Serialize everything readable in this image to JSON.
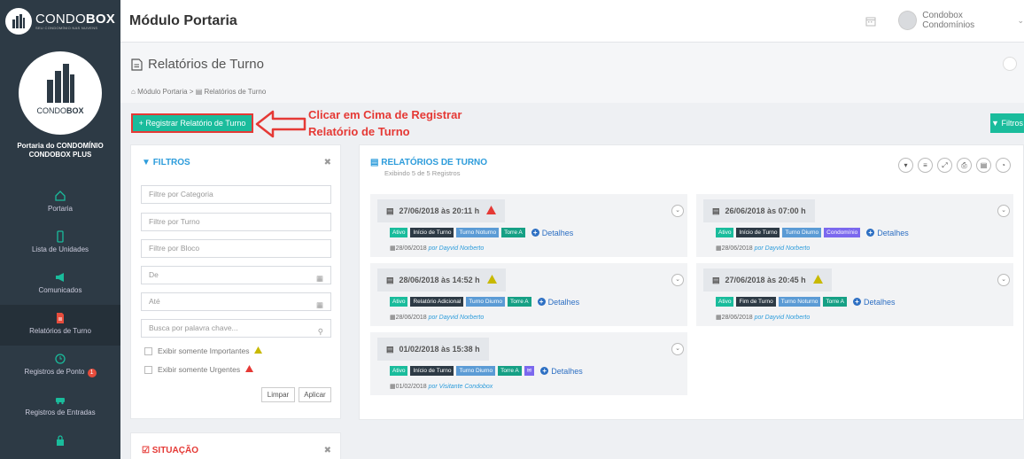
{
  "brand": {
    "name_light": "CONDO",
    "name_bold": "BOX",
    "tagline": "SEU CONDOMÍNIO NAS NUVENS"
  },
  "header": {
    "module_title": "Módulo Portaria",
    "user_name": "Condobox Condomínios"
  },
  "sidebar": {
    "logo_light": "CONDO",
    "logo_bold": "BOX",
    "portaria_name": "Portaria do CONDOMÍNIO CONDOBOX PLUS",
    "items": [
      {
        "label": "Portaria"
      },
      {
        "label": "Lista de Unidades"
      },
      {
        "label": "Comunicados"
      },
      {
        "label": "Relatórios de Turno"
      },
      {
        "label": "Registros de Ponto",
        "badge": "1"
      },
      {
        "label": "Registros de Entradas"
      }
    ]
  },
  "page": {
    "title": "Relatórios de Turno",
    "breadcrumb": {
      "home": "Módulo Portaria",
      "sep": ">",
      "current": "Relatórios de Turno"
    }
  },
  "toolbar": {
    "register_label": "+ Registrar Relatório de Turno",
    "filtros_label": "Filtros",
    "annotation_line1": "Clicar em Cima de Registrar",
    "annotation_line2": "Relatório de Turno"
  },
  "filters": {
    "title": "FILTROS",
    "categoria": "Filtre por Categoria",
    "turno": "Filtre por Turno",
    "bloco": "Filtre por Bloco",
    "de": "De",
    "ate": "Até",
    "busca": "Busca por palavra chave...",
    "importantes": "Exibir somente Importantes",
    "urgentes": "Exibir somente Urgentes",
    "limpar": "Limpar",
    "aplicar": "Aplicar"
  },
  "situacao": {
    "title": "SITUAÇÃO"
  },
  "reports": {
    "title": "RELATÓRIOS DE TURNO",
    "subtitle": "Exibindo 5 de 5 Registros",
    "details_label": "Detalhes",
    "cards": [
      {
        "title": "27/06/2018 às 20:11 h",
        "warn": "red",
        "tags": [
          "Ativo",
          "Início de Turno",
          "Turno Noturno",
          "Torre A"
        ],
        "date": "28/06/2018",
        "by": "por Dayvid Norberto"
      },
      {
        "title": "26/06/2018 às 07:00 h",
        "warn": "",
        "tags": [
          "Ativo",
          "Início de Turno",
          "Turno Diurno",
          "Condomínio"
        ],
        "date": "28/06/2018",
        "by": "por Dayvid Norberto"
      },
      {
        "title": "28/06/2018 às 14:52 h",
        "warn": "yellow",
        "tags": [
          "Ativo",
          "Relatório Adicional",
          "Turno Diurno",
          "Torre A"
        ],
        "date": "28/06/2018",
        "by": "por Dayvid Norberto"
      },
      {
        "title": "27/06/2018 às 20:45 h",
        "warn": "yellow",
        "tags": [
          "Ativo",
          "Fim de Turno",
          "Turno Noturno",
          "Torre A"
        ],
        "date": "28/06/2018",
        "by": "por Dayvid Norberto"
      },
      {
        "title": "01/02/2018 às 15:38 h",
        "warn": "",
        "tags": [
          "Ativo",
          "Início de Turno",
          "Turno Diurno",
          "Torre A"
        ],
        "date": "01/02/2018",
        "by": "por Visitante Condobox"
      }
    ]
  },
  "colors": {
    "sidebar": "#2d3a45",
    "accent": "#1abc9c",
    "link": "#2d6fc3",
    "annotation": "#e53935"
  }
}
